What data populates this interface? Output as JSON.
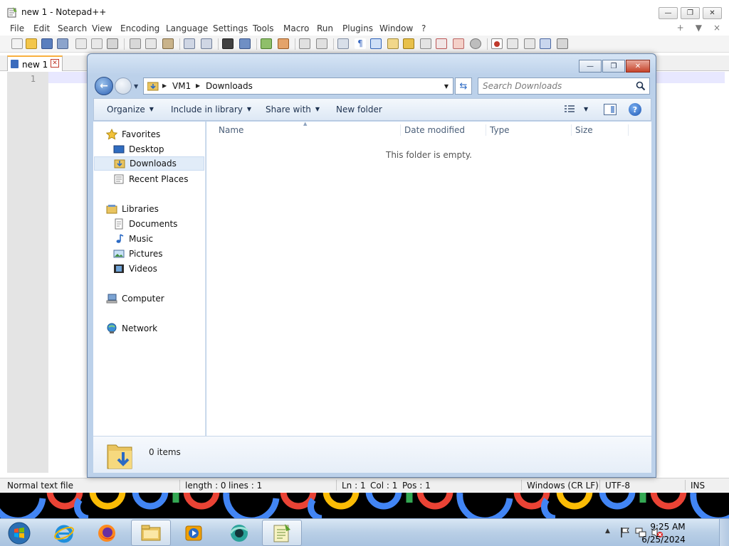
{
  "notepad": {
    "title": "new 1 - Notepad++",
    "menu": [
      "File",
      "Edit",
      "Search",
      "View",
      "Encoding",
      "Language",
      "Settings",
      "Tools",
      "Macro",
      "Run",
      "Plugins",
      "Window",
      "?"
    ],
    "menu_right": [
      "+",
      "▼",
      "×"
    ],
    "tab": {
      "label": "new 1",
      "close": "✕"
    },
    "editor": {
      "line_number": "1"
    },
    "status": {
      "file_type": "Normal text file",
      "length": "length : 0",
      "lines": "lines : 1",
      "ln": "Ln : 1",
      "col": "Col : 1",
      "pos": "Pos : 1",
      "eol": "Windows (CR LF)",
      "encoding": "UTF-8",
      "mode": "INS"
    }
  },
  "explorer": {
    "breadcrumbs": [
      "VM1",
      "Downloads"
    ],
    "search_placeholder": "Search Downloads",
    "commands": [
      "Organize",
      "Include in library",
      "Share with",
      "New folder"
    ],
    "nav": {
      "favorites_header": "Favorites",
      "favorites": [
        "Desktop",
        "Downloads",
        "Recent Places"
      ],
      "selected": "Downloads",
      "libraries_header": "Libraries",
      "libraries": [
        "Documents",
        "Music",
        "Pictures",
        "Videos"
      ],
      "computer": "Computer",
      "network": "Network"
    },
    "columns": [
      "Name",
      "Date modified",
      "Type",
      "Size"
    ],
    "empty_message": "This folder is empty.",
    "item_count": "0 items"
  },
  "taskbar": {
    "pinned": [
      "start-orb",
      "internet-explorer-icon",
      "firefox-icon",
      "file-explorer-icon",
      "media-player-icon",
      "chrome-like-icon",
      "notepad-plus-plus-icon"
    ],
    "time": "9:25 AM",
    "date": "6/25/2024"
  },
  "colors": {
    "accent_blue": "#2d62b5",
    "tab_highlight": "#f9b03f",
    "dialog_frame": "#bcd1ea",
    "google_blue": "#4285f4",
    "google_red": "#ea4335",
    "google_yellow": "#fbbc05",
    "google_green": "#34a853"
  }
}
